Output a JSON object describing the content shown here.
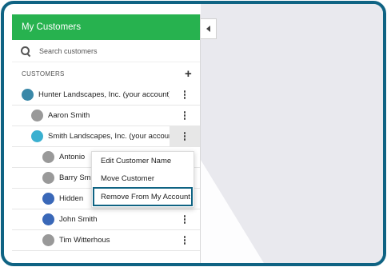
{
  "panel": {
    "title": "My Customers",
    "search_placeholder": "Search customers",
    "section_label": "CUSTOMERS",
    "add_icon": "plus-icon"
  },
  "customers": [
    {
      "name": "Hunter Landscapes, Inc. (your account)",
      "avatar_color": "#3a88a8"
    },
    {
      "name": "Aaron Smith",
      "avatar_color": "#999999"
    },
    {
      "name": "Smith Landscapes, Inc. (your account)",
      "avatar_color": "#3ab0d0"
    },
    {
      "name": "Antonio",
      "avatar_color": "#999999"
    },
    {
      "name": "Barry Smith",
      "avatar_color": "#999999"
    },
    {
      "name": "Hidden",
      "avatar_color": "#3a68b8"
    },
    {
      "name": "John Smith",
      "avatar_color": "#3a68b8"
    },
    {
      "name": "Tim Witterhous",
      "avatar_color": "#999999"
    }
  ],
  "context_menu": {
    "items": [
      "Edit Customer Name",
      "Move Customer",
      "Remove From My Account"
    ]
  },
  "colors": {
    "header": "#27b24f",
    "frame": "#0f6383"
  }
}
